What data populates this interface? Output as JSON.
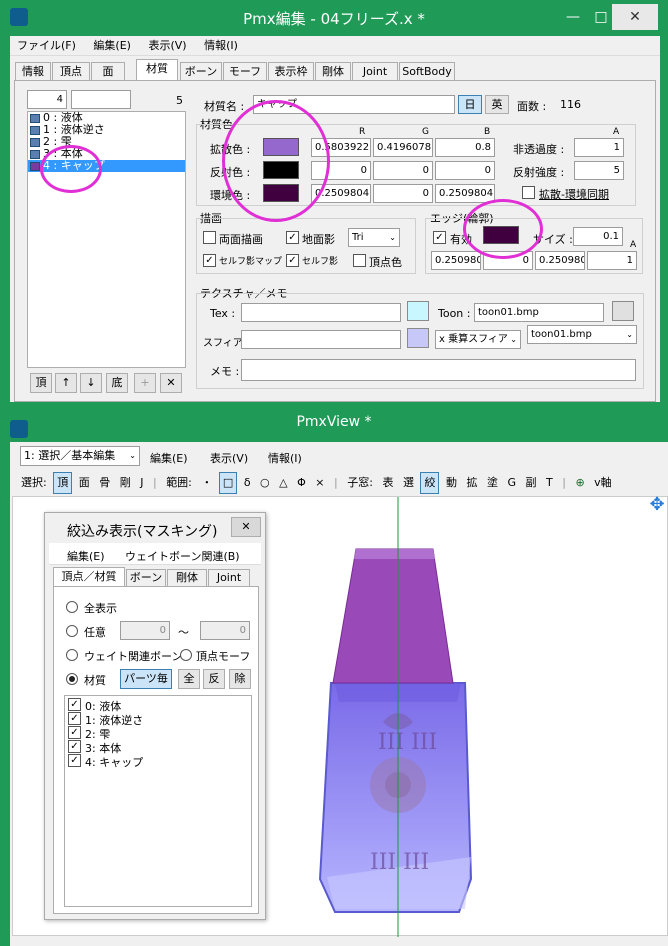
{
  "editor": {
    "title": "Pmx編集 - 04フリーズ.x *",
    "win_controls": {
      "minimize": "—",
      "maximize": "□",
      "close": "✕"
    },
    "menu": [
      "ファイル(F)",
      "編集(E)",
      "表示(V)",
      "情報(I)"
    ],
    "tabs": [
      "情報",
      "頂点",
      "面",
      "材質",
      "ボーン",
      "モーフ",
      "表示枠",
      "剛体",
      "Joint",
      "SoftBody"
    ],
    "active_tab": "材質",
    "index_value": "4",
    "count": "5",
    "materials": [
      "0 : 液体",
      "1 : 液体逆さ",
      "2 : 雫",
      "3 : 本体",
      "4 : キャップ"
    ],
    "selected_material": "4 : キャップ",
    "list_buttons": [
      "頂",
      "↑",
      "↓",
      "底",
      "+",
      "✕"
    ],
    "name_label": "材質名 :",
    "name_value": "キャップ",
    "lang_jp": "日",
    "lang_en": "英",
    "face_count_label": "面数 :",
    "face_count": "116",
    "material_color_label": "材質色",
    "rgba_headers": [
      "R",
      "G",
      "B",
      "A"
    ],
    "diffuse_label": "拡散色 :",
    "diffuse_values": [
      "0.5803922",
      "0.4196078",
      "0.8"
    ],
    "specular_label": "反射色 :",
    "specular_values": [
      "0",
      "0",
      "0"
    ],
    "ambient_label": "環境色 :",
    "ambient_values": [
      "0.2509804",
      "0",
      "0.2509804"
    ],
    "alpha_label": "非透過度 :",
    "alpha_value": "1",
    "spec_power_label": "反射強度 :",
    "spec_power_value": "5",
    "sync_label": "拡散-環境同期",
    "colors": {
      "diffuse": "#9468cc",
      "specular": "#000000",
      "ambient": "#400040",
      "edge": "#400040",
      "circle": "#e12fd6",
      "window": "#1f9a57",
      "model_cap": "#9a4ab8",
      "model_body": "#8c8cf0"
    },
    "draw_label": "描画",
    "draw_options": {
      "double_sided": "両面描画",
      "ground_shadow": "地面影",
      "tri": "Tri",
      "self_shadow_map": "セルフ影マップ",
      "self_shadow": "セルフ影",
      "vertex_color": "頂点色"
    },
    "edge_label": "エッジ(輪郭)",
    "edge_enabled": "有効",
    "edge_size_label": "サイズ :",
    "edge_size": "0.1",
    "edge_a_header": "A",
    "edge_values": [
      "0.250980",
      "0",
      "0.250980",
      "1"
    ],
    "texture_label": "テクスチャ／メモ",
    "tex_label": "Tex :",
    "tex_value": "",
    "toon_label": "Toon :",
    "toon_value": "toon01.bmp",
    "sphere_label": "スフィア :",
    "sphere_value": "",
    "sphere_mode": "x 乗算スフィア",
    "toon_select": "toon01.bmp",
    "memo_label": "メモ :",
    "memo_value": ""
  },
  "viewer": {
    "title": "PmxView *",
    "mode_select": "1: 選択／基本編集",
    "menu": [
      "編集(E)",
      "表示(V)",
      "情報(I)"
    ],
    "toolbar_select_label": "選択:",
    "toolbar_select": [
      "頂",
      "面",
      "骨",
      "剛",
      "J"
    ],
    "toolbar_range_label": "範囲:",
    "toolbar_range": [
      "・",
      "□",
      "δ",
      "○",
      "△",
      "Φ",
      "×"
    ],
    "toolbar_sub_label": "子窓:",
    "toolbar_sub": [
      "表",
      "選",
      "絞",
      "動",
      "拡",
      "塗",
      "G",
      "副",
      "T"
    ],
    "toolbar_end": "v軸",
    "mask_title": "絞込み表示(マスキング)",
    "mask_close": "✕",
    "mask_menu": [
      "編集(E)",
      "ウェイトボーン関連(B)"
    ],
    "mask_tabs": [
      "頂点／材質",
      "ボーン",
      "剛体",
      "Joint"
    ],
    "opt_all": "全表示",
    "opt_any": "任意",
    "any_from": "0",
    "tilde": "～",
    "any_to": "0",
    "opt_weight_bone": "ウェイト関連ボーン",
    "opt_vertex_morph": "頂点モーフ",
    "opt_material": "材質",
    "part_button": "パーツ毎",
    "btn_all": "全",
    "btn_invert": "反",
    "btn_remove": "除",
    "mask_items": [
      "0: 液体",
      "1: 液体逆さ",
      "2: 雫",
      "3: 本体",
      "4: キャップ"
    ],
    "crest_text": "III III"
  }
}
